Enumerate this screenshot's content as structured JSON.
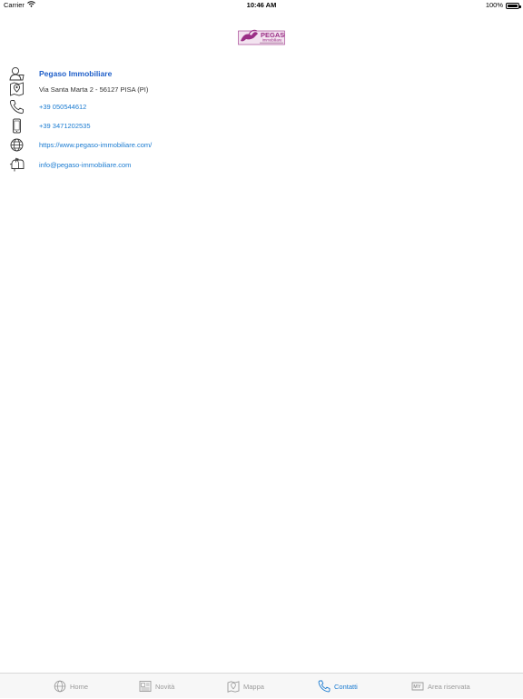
{
  "status_bar": {
    "carrier": "Carrier",
    "time": "10:46 AM",
    "battery_percent": "100%",
    "battery_level": 1.0
  },
  "header": {
    "logo_title": "PEGASO",
    "logo_subtitle": "immobiliare"
  },
  "contact": {
    "name": "Pegaso Immobiliare",
    "address": "Via Santa Marta 2 - 56127 PISA (PI)",
    "phone": "+39 050544612",
    "mobile": "+39 3471202535",
    "website": "https://www.pegaso-immobiliare.com/",
    "email": "info@pegaso-immobiliare.com"
  },
  "icons": {
    "name": "person-icon",
    "address": "map-pin-icon",
    "phone": "phone-icon",
    "mobile": "mobile-phone-icon",
    "website": "globe-icon",
    "email": "mailbox-icon"
  },
  "tab_bar": {
    "active": "Contatti",
    "accent_color": "#1a7bd1",
    "inactive_color": "#9a9a9a",
    "tabs": [
      {
        "label": "Home",
        "icon": "globe-icon"
      },
      {
        "label": "Novità",
        "icon": "newspaper-icon"
      },
      {
        "label": "Mappa",
        "icon": "map-icon"
      },
      {
        "label": "Contatti",
        "icon": "phone-icon"
      },
      {
        "label": "Area riservata",
        "icon": "my-area-icon"
      }
    ]
  }
}
